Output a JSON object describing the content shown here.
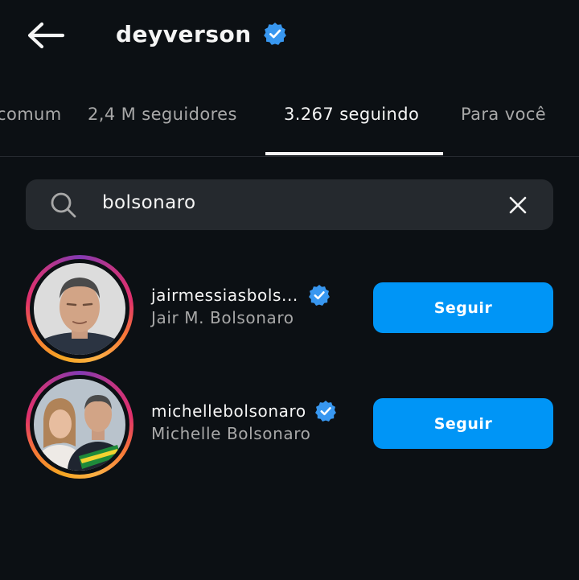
{
  "header": {
    "title": "deyverson",
    "verified": true,
    "back_icon": "arrow-left-icon"
  },
  "tabs": [
    {
      "label": "comum",
      "active": false
    },
    {
      "label": "2,4 M seguidores",
      "active": false
    },
    {
      "label": "3.267 seguindo",
      "active": true
    },
    {
      "label": "Para você",
      "active": false
    }
  ],
  "search": {
    "value": "bolsonaro",
    "icon": "search-icon",
    "clear_icon": "close-icon"
  },
  "results": [
    {
      "username": "jairmessiasbols...",
      "full_name": "Jair M. Bolsonaro",
      "verified": true,
      "button_label": "Seguir"
    },
    {
      "username": "michellebolsonaro",
      "full_name": "Michelle Bolsonaro",
      "verified": true,
      "button_label": "Seguir"
    }
  ],
  "colors": {
    "background": "#0c1014",
    "accent": "#0095f6",
    "verified": "#3897f0",
    "search_bg": "#25292e",
    "secondary_text": "#a8a8a8"
  }
}
